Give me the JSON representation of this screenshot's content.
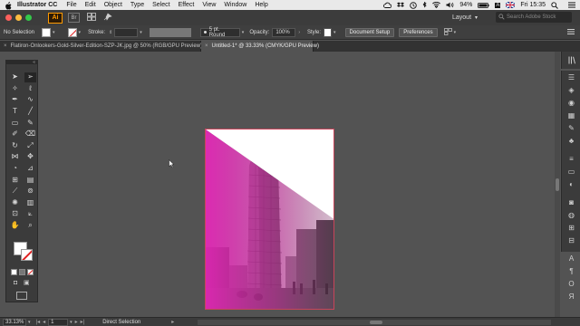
{
  "menubar": {
    "apple_icon": "apple-icon",
    "items": [
      "Illustrator CC",
      "File",
      "Edit",
      "Object",
      "Type",
      "Select",
      "Effect",
      "View",
      "Window",
      "Help"
    ],
    "battery": "94%",
    "input_menu": "A",
    "clock": "Fri 15:35"
  },
  "appbar": {
    "logo": "Ai",
    "bridge": "Br",
    "layout_label": "Layout",
    "search_placeholder": "Search Adobe Stock",
    "colors": {
      "close": "#fc605c",
      "minimize": "#fdbc40",
      "maximize": "#34c84a",
      "ai_orange": "#ff9a00"
    }
  },
  "controlbar": {
    "selection_status": "No Selection",
    "stroke_label": "Stroke:",
    "brush_value": "5 pt. Round",
    "opacity_label": "Opacity:",
    "opacity_value": "100%",
    "style_label": "Style:",
    "document_setup": "Document Setup",
    "preferences": "Preferences"
  },
  "tabs": [
    {
      "label": "Flatiron-Onlookers-Gold-Silver-Edition-SZP-JK.jpg @ 50% (RGB/GPU Preview)",
      "active": false
    },
    {
      "label": "Untitled-1* @ 33.33% (CMYK/GPU Preview)",
      "active": true
    }
  ],
  "tools": [
    [
      "selection-tool",
      "direct-selection-tool"
    ],
    [
      "magic-wand-tool",
      "lasso-tool"
    ],
    [
      "pen-tool",
      "curvature-tool"
    ],
    [
      "type-tool",
      "line-segment-tool"
    ],
    [
      "rectangle-tool",
      "paintbrush-tool"
    ],
    [
      "shaper-tool",
      "eraser-tool"
    ],
    [
      "rotate-tool",
      "scale-tool"
    ],
    [
      "width-tool",
      "puppet-warp-tool"
    ],
    [
      "shape-builder-tool",
      "perspective-grid-tool"
    ],
    [
      "mesh-tool",
      "gradient-tool"
    ],
    [
      "eyedropper-tool",
      "blend-tool"
    ],
    [
      "symbol-sprayer-tool",
      "column-graph-tool"
    ],
    [
      "artboard-tool",
      "slice-tool"
    ],
    [
      "hand-tool",
      "zoom-tool"
    ]
  ],
  "statusbar": {
    "zoom": "33.13%",
    "artboard_number": "1",
    "tool_status": "Direct Selection"
  },
  "artboard": {
    "colors": {
      "border": "#c8455a",
      "magenta_overlay": "#e026b4"
    }
  }
}
